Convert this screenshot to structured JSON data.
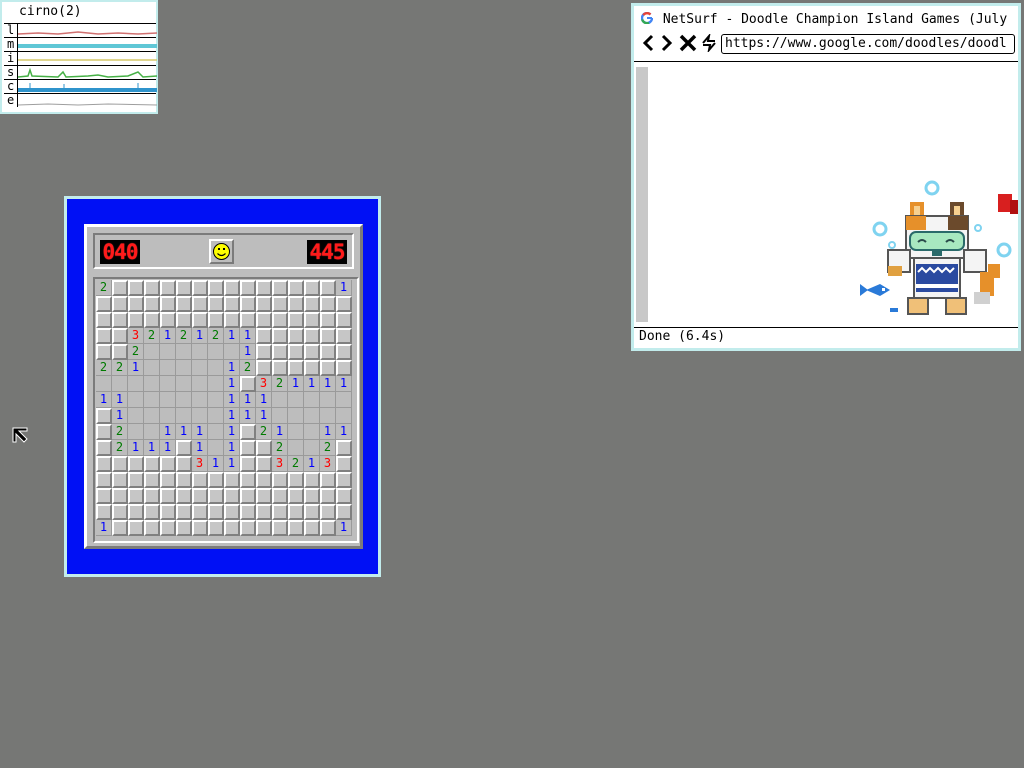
{
  "stats": {
    "title": "cirno(2)",
    "rows": [
      {
        "label": "l",
        "color": "#d07070"
      },
      {
        "label": "m",
        "color": "#5fc7d6"
      },
      {
        "label": "i",
        "color": "#d6c96a"
      },
      {
        "label": "s",
        "color": "#46b046"
      },
      {
        "label": "c",
        "color": "#2f94cc"
      },
      {
        "label": "e",
        "color": "#9e9e9e"
      }
    ]
  },
  "minesweeper": {
    "mine_count": "040",
    "timer": "445",
    "grid": [
      [
        "2",
        "#",
        "#",
        "#",
        "#",
        "#",
        "#",
        "#",
        "#",
        "#",
        "#",
        "#",
        "#",
        "#",
        "#",
        "1"
      ],
      [
        "#",
        "#",
        "#",
        "#",
        "#",
        "#",
        "#",
        "#",
        "#",
        "#",
        "#",
        "#",
        "#",
        "#",
        "#",
        "#"
      ],
      [
        "#",
        "#",
        "#",
        "#",
        "#",
        "#",
        "#",
        "#",
        "#",
        "#",
        "#",
        "#",
        "#",
        "#",
        "#",
        "#"
      ],
      [
        "#",
        "#",
        "3",
        "2",
        "1",
        "2",
        "1",
        "2",
        "1",
        "1",
        "#",
        "#",
        "#",
        "#",
        "#",
        "#"
      ],
      [
        "#",
        "#",
        "2",
        ".",
        ".",
        ".",
        ".",
        ".",
        ".",
        "1",
        "#",
        "#",
        "#",
        "#",
        "#",
        "#"
      ],
      [
        "2",
        "2",
        "1",
        ".",
        ".",
        ".",
        ".",
        ".",
        "1",
        "2",
        "#",
        "#",
        "#",
        "#",
        "#",
        "#"
      ],
      [
        ".",
        ".",
        ".",
        ".",
        ".",
        ".",
        ".",
        ".",
        "1",
        "#",
        "3",
        "2",
        "1",
        "1",
        "1",
        "1"
      ],
      [
        "1",
        "1",
        ".",
        ".",
        ".",
        ".",
        ".",
        ".",
        "1",
        "1",
        "1",
        ".",
        ".",
        ".",
        ".",
        "."
      ],
      [
        "#",
        "1",
        ".",
        ".",
        ".",
        ".",
        ".",
        ".",
        "1",
        "1",
        "1",
        ".",
        ".",
        ".",
        ".",
        "."
      ],
      [
        "#",
        "2",
        ".",
        ".",
        "1",
        "1",
        "1",
        ".",
        "1",
        "#",
        "2",
        "1",
        ".",
        ".",
        "1",
        "1"
      ],
      [
        "#",
        "2",
        "1",
        "1",
        "1",
        "#",
        "1",
        ".",
        "1",
        "#",
        "#",
        "2",
        ".",
        ".",
        "2",
        "#"
      ],
      [
        "#",
        "#",
        "#",
        "#",
        "#",
        "#",
        "3",
        "1",
        "1",
        "#",
        "#",
        "3",
        "2",
        "1",
        "3",
        "#"
      ],
      [
        "#",
        "#",
        "#",
        "#",
        "#",
        "#",
        "#",
        "#",
        "#",
        "#",
        "#",
        "#",
        "#",
        "#",
        "#",
        "#"
      ],
      [
        "#",
        "#",
        "#",
        "#",
        "#",
        "#",
        "#",
        "#",
        "#",
        "#",
        "#",
        "#",
        "#",
        "#",
        "#",
        "#"
      ],
      [
        "#",
        "#",
        "#",
        "#",
        "#",
        "#",
        "#",
        "#",
        "#",
        "#",
        "#",
        "#",
        "#",
        "#",
        "#",
        "#"
      ],
      [
        "1",
        "#",
        "#",
        "#",
        "#",
        "#",
        "#",
        "#",
        "#",
        "#",
        "#",
        "#",
        "#",
        "#",
        "#",
        "1"
      ]
    ]
  },
  "browser": {
    "title": "NetSurf - Doodle Champion Island Games (July",
    "favicon": "G",
    "url": "https://www.google.com/doodles/doodl",
    "status": "Done (6.4s)",
    "nav": {
      "back": "<",
      "forward": ">",
      "stop": "✕",
      "reload": "↯"
    }
  }
}
